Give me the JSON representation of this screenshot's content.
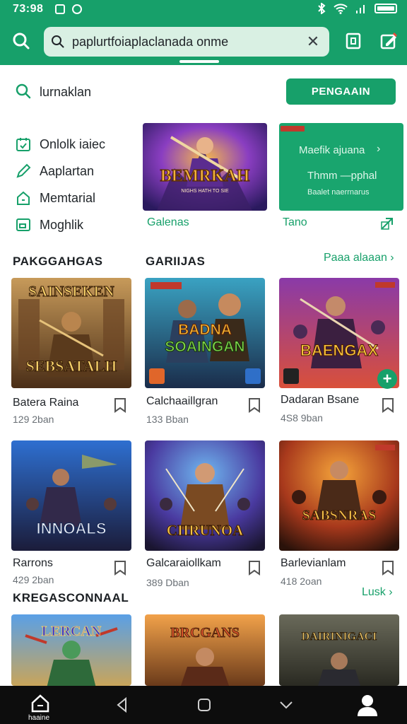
{
  "status_bar": {
    "time": "73:98"
  },
  "app_bar": {
    "search_query": "paplurtfoiaplaclanada onme",
    "clear_glyph": "✕"
  },
  "search_row": {
    "label": "lurnaklan",
    "button_label": "PENGAAIN"
  },
  "menu": {
    "items": [
      {
        "label": "Onlolk iaiec",
        "icon": "calendar-icon"
      },
      {
        "label": "Aaplartan",
        "icon": "pencil-icon"
      },
      {
        "label": "Memtarial",
        "icon": "home-icon"
      },
      {
        "label": "Moghlik",
        "icon": "window-icon"
      }
    ]
  },
  "featured": {
    "card1": {
      "art_title": "BEMRKAH",
      "art_subtitle": "NIGHS HATH TO SIE",
      "caption": "Galenas"
    },
    "card2": {
      "line1": "Maefik ajuana",
      "line2": "Thmm —pphal",
      "line3": "Baalet naerrnarus",
      "caption": "Tano"
    }
  },
  "sections": [
    {
      "title": "PAKGGAHGAS",
      "subtitle": "GARIIJAS",
      "link": "Paaa alaaan",
      "games": [
        {
          "title": "Batera Raina",
          "meta": "129 2ban",
          "art": "SAINSEKEN",
          "art2": "SEBSATALH"
        },
        {
          "title": "Calchaaillgran",
          "meta": "133 Bban",
          "art": "BADNA",
          "art2": "SOAINGAN"
        },
        {
          "title": "Dadaran Bsane",
          "meta": "4S8 9ban",
          "art": "BAENGAX",
          "art2": ""
        }
      ]
    },
    {
      "title": "",
      "subtitle": "",
      "link": "",
      "games": [
        {
          "title": "Rarrons",
          "meta": "429 2ban",
          "art": "INNOALS",
          "art2": ""
        },
        {
          "title": "Galcaraiollkam",
          "meta": "389 Dban",
          "art": "CIIRUNOA",
          "art2": ""
        },
        {
          "title": "Barlevianlam",
          "meta": "418 2oan",
          "art": "SABSNRAS",
          "art2": ""
        }
      ]
    },
    {
      "title": "KREGASCONNAAL",
      "subtitle": "",
      "link": "Lusk",
      "games": [
        {
          "art": "LERCAN",
          "art2": ""
        },
        {
          "art": "BRCGANS",
          "art2": ""
        },
        {
          "art": "DAIRINIGACI",
          "art2": ""
        }
      ]
    }
  ],
  "bottom_nav": {
    "home_label": "haaine"
  },
  "colors": {
    "accent": "#17a06a",
    "nav": "#0d0d0d"
  }
}
